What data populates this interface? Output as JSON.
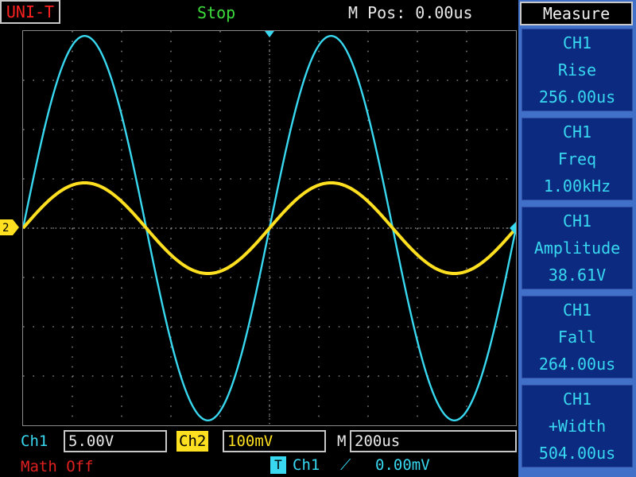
{
  "header": {
    "brand": "UNI-T",
    "status": "Stop",
    "m_pos": "M Pos: 0.00us"
  },
  "panel": {
    "title": "Measure",
    "measurements": [
      {
        "channel": "CH1",
        "name": "Rise",
        "value": "256.00us"
      },
      {
        "channel": "CH1",
        "name": "Freq",
        "value": "1.00kHz"
      },
      {
        "channel": "CH1",
        "name": "Amplitude",
        "value": "38.61V"
      },
      {
        "channel": "CH1",
        "name": "Fall",
        "value": "264.00us"
      },
      {
        "channel": "CH1",
        "name": "+Width",
        "value": "504.00us"
      }
    ]
  },
  "footer": {
    "ch1_label": "Ch1",
    "ch1_scale": "5.00V",
    "ch2_label": "Ch2",
    "ch2_scale": "100mV",
    "time_label": "M",
    "time_scale": "200us",
    "math": "Math Off",
    "trigger_icon": "T",
    "trigger_source": "Ch1",
    "trigger_slope": "⟋",
    "trigger_level": "0.00mV"
  },
  "markers": {
    "ch2_marker": "2"
  },
  "colors": {
    "ch1": "#38d8f0",
    "ch2": "#ffe020",
    "status": "#3cdc3c",
    "brand": "#ff2020",
    "math": "#e02020",
    "panel_bg": "#4070c8",
    "box_bg": "#0c2a80"
  },
  "icons": {
    "trigger_position": "trigger-position-arrow-icon",
    "ch2_ground": "ch2-ground-marker-icon",
    "ch1_ground": "ch1-ground-marker-icon",
    "slope": "rising-edge-slope-icon"
  },
  "waveforms": [
    {
      "name": "Ch1",
      "frequency_hz": 1000,
      "amplitude_divs": 3.9
    },
    {
      "name": "Ch2",
      "frequency_hz": 1000,
      "amplitude_divs": 0.92
    }
  ]
}
